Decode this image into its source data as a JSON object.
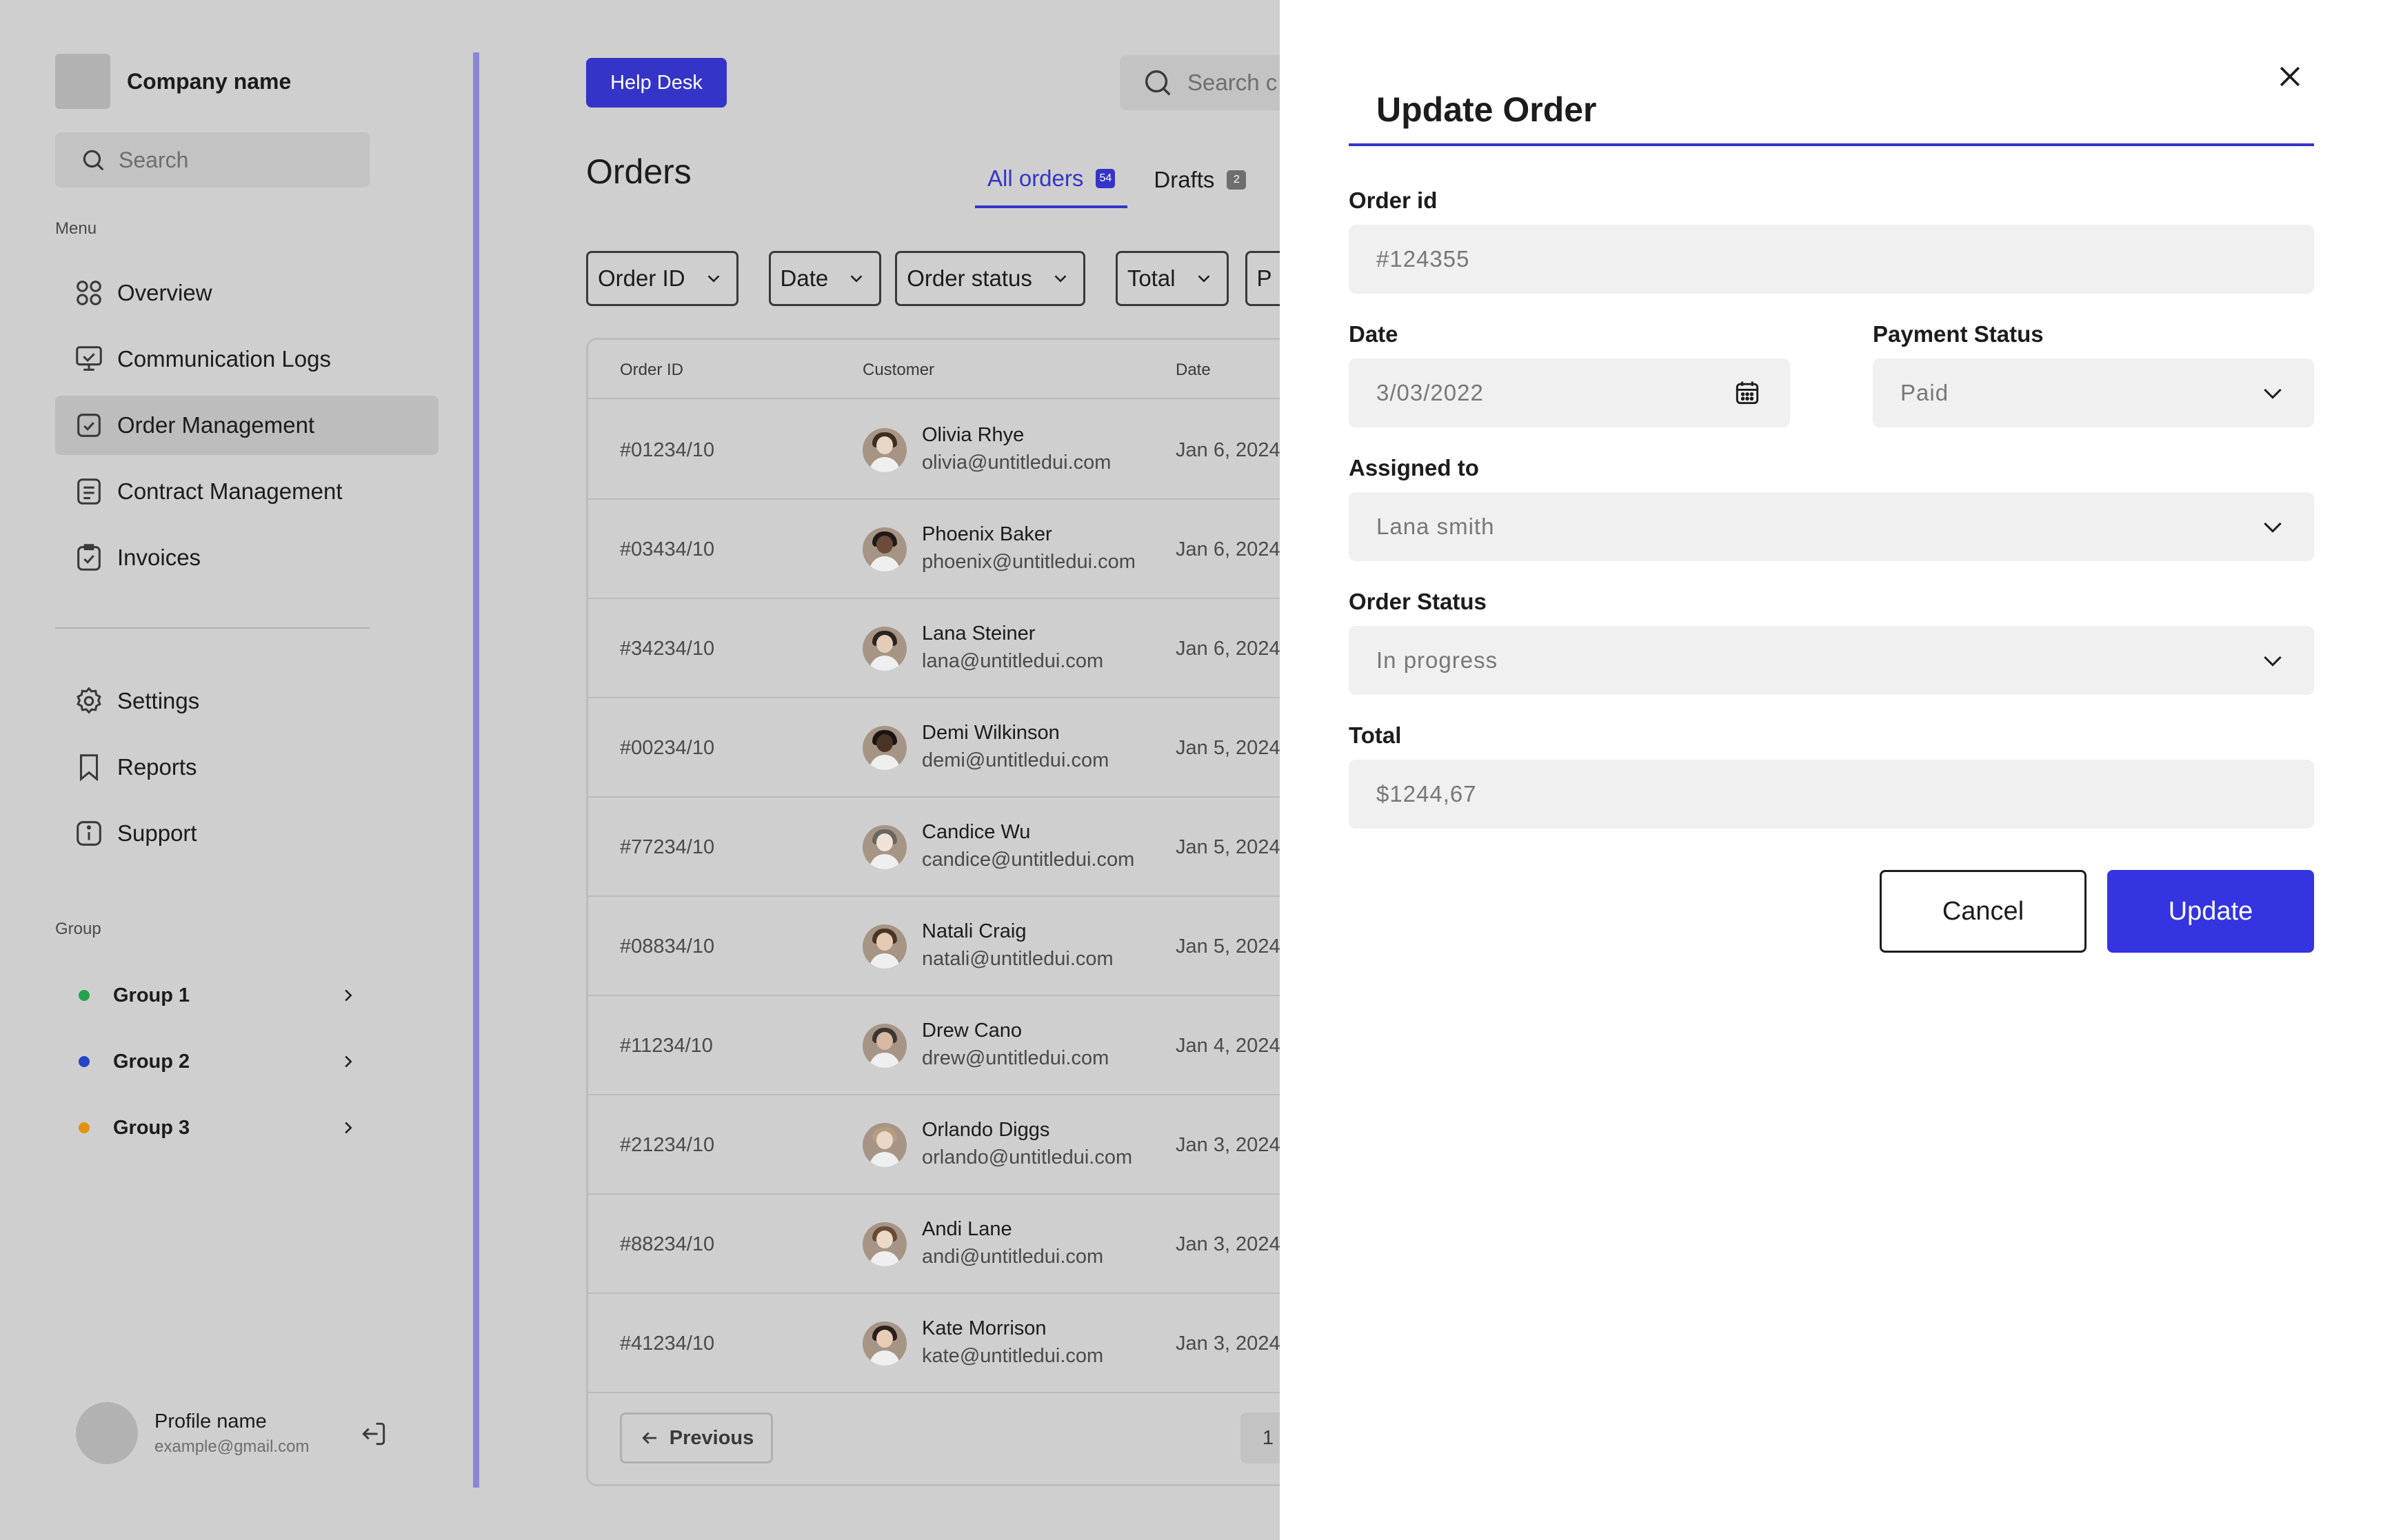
{
  "sidebar": {
    "company_name": "Company name",
    "search_placeholder": "Search",
    "menu_label": "Menu",
    "menu_items": [
      {
        "label": "Overview",
        "icon": "grid-icon"
      },
      {
        "label": "Communication Logs",
        "icon": "monitor-icon"
      },
      {
        "label": "Order Management",
        "icon": "checkbox-icon",
        "active": true
      },
      {
        "label": "Contract Management",
        "icon": "document-icon"
      },
      {
        "label": "Invoices",
        "icon": "clipboard-check-icon"
      }
    ],
    "settings_items": [
      {
        "label": "Settings",
        "icon": "gear-icon"
      },
      {
        "label": "Reports",
        "icon": "bookmark-icon"
      },
      {
        "label": "Support",
        "icon": "info-icon"
      }
    ],
    "group_label": "Group",
    "groups": [
      {
        "label": "Group 1",
        "color": "#22a34a"
      },
      {
        "label": "Group 2",
        "color": "#2146c7"
      },
      {
        "label": "Group 3",
        "color": "#e0940a"
      }
    ],
    "profile": {
      "name": "Profile name",
      "email": "example@gmail.com"
    }
  },
  "main": {
    "help_desk_label": "Help Desk",
    "search_placeholder": "Search c",
    "title": "Orders",
    "tabs": [
      {
        "label": "All orders",
        "badge": "54",
        "active": true
      },
      {
        "label": "Drafts",
        "badge": "2"
      }
    ],
    "filters": [
      "Order ID",
      "Date",
      "Order status",
      "Total",
      "P"
    ],
    "table": {
      "headers": {
        "order_id": "Order ID",
        "customer": "Customer",
        "date": "Date"
      },
      "rows": [
        {
          "id": "#01234/10",
          "name": "Olivia Rhye",
          "email": "olivia@untitledui.com",
          "date": "Jan 6, 2024"
        },
        {
          "id": "#03434/10",
          "name": "Phoenix Baker",
          "email": "phoenix@untitledui.com",
          "date": "Jan 6, 2024"
        },
        {
          "id": "#34234/10",
          "name": "Lana Steiner",
          "email": "lana@untitledui.com",
          "date": "Jan 6, 2024"
        },
        {
          "id": "#00234/10",
          "name": "Demi Wilkinson",
          "email": "demi@untitledui.com",
          "date": "Jan 5, 2024"
        },
        {
          "id": "#77234/10",
          "name": "Candice Wu",
          "email": "candice@untitledui.com",
          "date": "Jan 5, 2024"
        },
        {
          "id": "#08834/10",
          "name": "Natali Craig",
          "email": "natali@untitledui.com",
          "date": "Jan 5, 2024"
        },
        {
          "id": "#11234/10",
          "name": "Drew Cano",
          "email": "drew@untitledui.com",
          "date": "Jan 4, 2024"
        },
        {
          "id": "#21234/10",
          "name": "Orlando Diggs",
          "email": "orlando@untitledui.com",
          "date": "Jan 3, 2024"
        },
        {
          "id": "#88234/10",
          "name": "Andi Lane",
          "email": "andi@untitledui.com",
          "date": "Jan 3, 2024"
        },
        {
          "id": "#41234/10",
          "name": "Kate Morrison",
          "email": "kate@untitledui.com",
          "date": "Jan 3, 2024"
        }
      ]
    },
    "pagination": {
      "previous_label": "Previous",
      "current_page": "1"
    }
  },
  "drawer": {
    "title": "Update Order",
    "order_id": {
      "label": "Order id",
      "value": "#124355"
    },
    "date": {
      "label": "Date",
      "value": "3/03/2022"
    },
    "payment_status": {
      "label": "Payment Status",
      "value": "Paid"
    },
    "assigned_to": {
      "label": "Assigned to",
      "value": "Lana smith"
    },
    "order_status": {
      "label": "Order Status",
      "value": "In progress"
    },
    "total": {
      "label": "Total",
      "value": "$1244,67"
    },
    "cancel_label": "Cancel",
    "update_label": "Update"
  },
  "colors": {
    "accent": "#3434c8",
    "update_button": "#3434e0",
    "overlay": "#cfcfcf"
  }
}
